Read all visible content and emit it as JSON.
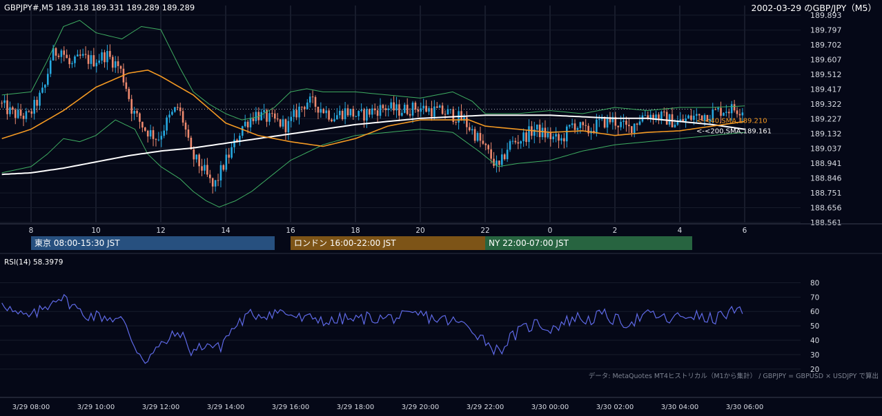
{
  "header": {
    "symbol_info": "GBPJPY#,M5 189.318 189.331 189.289 189.289",
    "title": "2002-03-29 のGBP/JPY（M5）"
  },
  "indicators": {
    "sma40_label": "<-<40,SMA,189.210",
    "sma200_label": "<-<200,SMA,189.161",
    "rsi_label": "RSI(14) 58.3979",
    "source_note": "データ: MetaQuotes MT4ヒストリカル（M1から集計） / GBPJPY = GBPUSD × USDJPY で算出"
  },
  "sessions": [
    {
      "label": "東京 08:00-15:30 JST",
      "color": "#27507f",
      "start": 0,
      "end": 7.5
    },
    {
      "label": "ロンドン 16:00-22:00 JST",
      "color": "#7d5417",
      "start": 8,
      "end": 14
    },
    {
      "label": "NY 22:00-07:00 JST",
      "color": "#276440",
      "start": 14,
      "end": 22
    }
  ],
  "colors": {
    "background": "#050817",
    "bull": "#26a9e0",
    "bear": "#ef8a6f",
    "sma40": "#f59a23",
    "sma200": "#ffffff",
    "bollinger": "#3fae62",
    "rsi": "#5f6ae8",
    "sma40_text": "#f59a23"
  },
  "chart_data": [
    {
      "type": "candlestick",
      "timeframe": "M5",
      "y_ticks": [
        189.893,
        189.797,
        189.702,
        189.607,
        189.512,
        189.417,
        189.322,
        189.227,
        189.132,
        189.037,
        188.941,
        188.846,
        188.751,
        188.656,
        188.561
      ],
      "ylim": [
        188.561,
        189.893
      ],
      "x_ticks": [
        "8",
        "10",
        "12",
        "14",
        "16",
        "18",
        "20",
        "22",
        "0",
        "2",
        "4",
        "6"
      ],
      "x_tick_hours": [
        0,
        2,
        4,
        6,
        8,
        10,
        12,
        14,
        16,
        18,
        20,
        22
      ],
      "xlim_hours": [
        -0.9,
        22.1
      ],
      "x_start_time": "3/29 08:00",
      "reference_line": 189.289,
      "anchors": [
        [
          -0.9,
          189.33
        ],
        [
          -0.5,
          189.26
        ],
        [
          0,
          189.24
        ],
        [
          0.5,
          189.42
        ],
        [
          0.7,
          189.63
        ],
        [
          1.0,
          189.68
        ],
        [
          1.3,
          189.56
        ],
        [
          1.6,
          189.62
        ],
        [
          2.0,
          189.6
        ],
        [
          2.4,
          189.64
        ],
        [
          2.8,
          189.56
        ],
        [
          3.0,
          189.45
        ],
        [
          3.2,
          189.28
        ],
        [
          3.6,
          189.16
        ],
        [
          4.0,
          189.1
        ],
        [
          4.3,
          189.22
        ],
        [
          4.6,
          189.3
        ],
        [
          4.8,
          189.2
        ],
        [
          5.0,
          189.0
        ],
        [
          5.4,
          188.9
        ],
        [
          5.7,
          188.78
        ],
        [
          6.0,
          188.92
        ],
        [
          6.3,
          189.04
        ],
        [
          6.6,
          189.18
        ],
        [
          7.0,
          189.26
        ],
        [
          7.5,
          189.22
        ],
        [
          8.0,
          189.18
        ],
        [
          8.3,
          189.28
        ],
        [
          8.6,
          189.34
        ],
        [
          9.0,
          189.3
        ],
        [
          9.4,
          189.24
        ],
        [
          9.8,
          189.28
        ],
        [
          10.2,
          189.24
        ],
        [
          10.6,
          189.28
        ],
        [
          11.0,
          189.3
        ],
        [
          11.4,
          189.28
        ],
        [
          12.0,
          189.3
        ],
        [
          12.5,
          189.28
        ],
        [
          13.0,
          189.26
        ],
        [
          13.4,
          189.22
        ],
        [
          13.8,
          189.12
        ],
        [
          14.2,
          189.0
        ],
        [
          14.5,
          188.9
        ],
        [
          14.8,
          189.06
        ],
        [
          15.2,
          189.1
        ],
        [
          15.6,
          189.16
        ],
        [
          16.0,
          189.12
        ],
        [
          16.4,
          189.08
        ],
        [
          16.8,
          189.2
        ],
        [
          17.2,
          189.14
        ],
        [
          17.6,
          189.2
        ],
        [
          18.0,
          189.22
        ],
        [
          18.5,
          189.16
        ],
        [
          19.0,
          189.26
        ],
        [
          19.5,
          189.24
        ],
        [
          20.0,
          189.2
        ],
        [
          20.5,
          189.24
        ],
        [
          21.0,
          189.26
        ],
        [
          21.5,
          189.29
        ],
        [
          22.0,
          189.29
        ]
      ],
      "series": [
        {
          "name": "40,SMA",
          "last": 189.21,
          "anchors": [
            [
              -0.9,
              189.1
            ],
            [
              0,
              189.16
            ],
            [
              1,
              189.28
            ],
            [
              2,
              189.43
            ],
            [
              3,
              189.52
            ],
            [
              3.6,
              189.54
            ],
            [
              4,
              189.5
            ],
            [
              5,
              189.38
            ],
            [
              6,
              189.2
            ],
            [
              7,
              189.12
            ],
            [
              8,
              189.08
            ],
            [
              9,
              189.05
            ],
            [
              10,
              189.1
            ],
            [
              11,
              189.18
            ],
            [
              12,
              189.22
            ],
            [
              13,
              189.22
            ],
            [
              13.5,
              189.22
            ],
            [
              14,
              189.18
            ],
            [
              15,
              189.16
            ],
            [
              16,
              189.14
            ],
            [
              17,
              189.15
            ],
            [
              18,
              189.12
            ],
            [
              19,
              189.14
            ],
            [
              20,
              189.15
            ],
            [
              21,
              189.18
            ],
            [
              22,
              189.21
            ]
          ]
        },
        {
          "name": "200,SMA",
          "last": 189.161,
          "anchors": [
            [
              -0.9,
              188.87
            ],
            [
              0,
              188.88
            ],
            [
              1,
              188.91
            ],
            [
              2,
              188.95
            ],
            [
              3,
              188.99
            ],
            [
              4,
              189.02
            ],
            [
              5,
              189.04
            ],
            [
              6,
              189.07
            ],
            [
              7,
              189.1
            ],
            [
              8,
              189.13
            ],
            [
              9,
              189.16
            ],
            [
              10,
              189.19
            ],
            [
              11,
              189.21
            ],
            [
              12,
              189.23
            ],
            [
              13,
              189.24
            ],
            [
              14,
              189.25
            ],
            [
              15,
              189.25
            ],
            [
              16,
              189.25
            ],
            [
              17,
              189.24
            ],
            [
              18,
              189.23
            ],
            [
              19,
              189.23
            ],
            [
              20,
              189.21
            ],
            [
              21,
              189.19
            ],
            [
              22,
              189.16
            ]
          ]
        }
      ],
      "bollinger_upper": [
        [
          -0.9,
          189.38
        ],
        [
          0,
          189.4
        ],
        [
          0.5,
          189.6
        ],
        [
          1,
          189.82
        ],
        [
          1.5,
          189.86
        ],
        [
          2,
          189.78
        ],
        [
          2.8,
          189.74
        ],
        [
          3.4,
          189.82
        ],
        [
          4,
          189.8
        ],
        [
          4.6,
          189.55
        ],
        [
          5,
          189.4
        ],
        [
          5.5,
          189.32
        ],
        [
          6,
          189.26
        ],
        [
          6.5,
          189.22
        ],
        [
          7,
          189.24
        ],
        [
          7.5,
          189.3
        ],
        [
          8,
          189.4
        ],
        [
          8.5,
          189.42
        ],
        [
          9,
          189.4
        ],
        [
          10,
          189.4
        ],
        [
          11,
          189.38
        ],
        [
          12,
          189.36
        ],
        [
          13,
          189.4
        ],
        [
          13.6,
          189.34
        ],
        [
          14,
          189.26
        ],
        [
          15,
          189.26
        ],
        [
          16,
          189.28
        ],
        [
          17,
          189.26
        ],
        [
          18,
          189.3
        ],
        [
          19,
          189.28
        ],
        [
          20,
          189.3
        ],
        [
          21,
          189.3
        ],
        [
          22,
          189.31
        ]
      ],
      "bollinger_lower": [
        [
          -0.9,
          188.88
        ],
        [
          0,
          188.92
        ],
        [
          0.5,
          189.0
        ],
        [
          1,
          189.1
        ],
        [
          1.5,
          189.08
        ],
        [
          2,
          189.12
        ],
        [
          2.6,
          189.22
        ],
        [
          3.2,
          189.16
        ],
        [
          3.6,
          189.0
        ],
        [
          4,
          188.92
        ],
        [
          4.6,
          188.84
        ],
        [
          5,
          188.76
        ],
        [
          5.4,
          188.7
        ],
        [
          5.8,
          188.66
        ],
        [
          6.3,
          188.7
        ],
        [
          6.8,
          188.76
        ],
        [
          7.4,
          188.86
        ],
        [
          8,
          188.96
        ],
        [
          8.6,
          189.02
        ],
        [
          9,
          189.06
        ],
        [
          10,
          189.12
        ],
        [
          11,
          189.14
        ],
        [
          12,
          189.16
        ],
        [
          13,
          189.14
        ],
        [
          13.8,
          189.02
        ],
        [
          14.4,
          188.92
        ],
        [
          15,
          188.94
        ],
        [
          16,
          188.96
        ],
        [
          17,
          189.02
        ],
        [
          18,
          189.06
        ],
        [
          19,
          189.08
        ],
        [
          20,
          189.1
        ],
        [
          21,
          189.12
        ],
        [
          22,
          189.14
        ]
      ]
    },
    {
      "type": "line",
      "name": "RSI(14)",
      "last": 58.3979,
      "y_ticks": [
        80,
        70,
        60,
        50,
        40,
        30,
        20
      ],
      "ylim": [
        18,
        85
      ],
      "anchors": [
        [
          -0.9,
          68
        ],
        [
          -0.5,
          58
        ],
        [
          0,
          56
        ],
        [
          0.5,
          64
        ],
        [
          0.8,
          71
        ],
        [
          1.2,
          66
        ],
        [
          1.6,
          58
        ],
        [
          2.0,
          57
        ],
        [
          2.4,
          56
        ],
        [
          2.8,
          54
        ],
        [
          3.0,
          46
        ],
        [
          3.2,
          36
        ],
        [
          3.5,
          26
        ],
        [
          3.8,
          32
        ],
        [
          4.2,
          40
        ],
        [
          4.6,
          46
        ],
        [
          4.8,
          36
        ],
        [
          5.0,
          32
        ],
        [
          5.4,
          38
        ],
        [
          5.8,
          34
        ],
        [
          6.0,
          42
        ],
        [
          6.4,
          52
        ],
        [
          6.8,
          58
        ],
        [
          7.2,
          58
        ],
        [
          7.6,
          60
        ],
        [
          8.0,
          58
        ],
        [
          8.4,
          54
        ],
        [
          8.8,
          56
        ],
        [
          9.2,
          52
        ],
        [
          9.6,
          55
        ],
        [
          10.0,
          54
        ],
        [
          10.4,
          56
        ],
        [
          10.8,
          55
        ],
        [
          11.2,
          56
        ],
        [
          11.6,
          56
        ],
        [
          12.0,
          58
        ],
        [
          12.4,
          55
        ],
        [
          12.8,
          54
        ],
        [
          13.2,
          52
        ],
        [
          13.6,
          48
        ],
        [
          14.0,
          40
        ],
        [
          14.4,
          32
        ],
        [
          14.8,
          42
        ],
        [
          15.2,
          48
        ],
        [
          15.6,
          52
        ],
        [
          16.0,
          48
        ],
        [
          16.4,
          52
        ],
        [
          16.8,
          56
        ],
        [
          17.2,
          54
        ],
        [
          17.6,
          58
        ],
        [
          18.0,
          54
        ],
        [
          18.4,
          52
        ],
        [
          18.8,
          56
        ],
        [
          19.2,
          58
        ],
        [
          19.6,
          54
        ],
        [
          20.0,
          56
        ],
        [
          20.4,
          58
        ],
        [
          20.8,
          54
        ],
        [
          21.2,
          56
        ],
        [
          21.6,
          60
        ],
        [
          22.0,
          58
        ]
      ]
    }
  ],
  "rsi_time_axis": [
    "3/29 08:00",
    "3/29 10:00",
    "3/29 12:00",
    "3/29 14:00",
    "3/29 16:00",
    "3/29 18:00",
    "3/29 20:00",
    "3/29 22:00",
    "3/30 00:00",
    "3/30 02:00",
    "3/30 04:00",
    "3/30 06:00"
  ]
}
